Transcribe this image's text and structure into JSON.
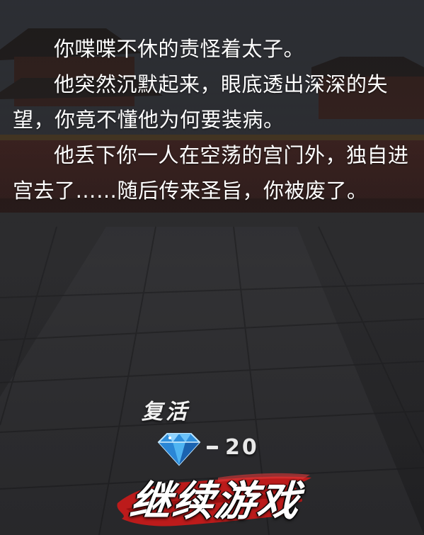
{
  "story": {
    "paragraphs": [
      "你喋喋不休的责怪着太子。",
      "他突然沉默起来，眼底透出深深的失望，你竟不懂他为何要装病。",
      "他丢下你一人在空荡的宫门外，独自进宫去了……随后传来圣旨，你被废了。"
    ]
  },
  "revive": {
    "label": "复活",
    "cost": "20",
    "currency_icon": "diamond-icon"
  },
  "continue_button": {
    "label": "继续游戏"
  },
  "colors": {
    "text": "#ffffff",
    "brush_red": "#c41a1a",
    "diamond_blue": "#3aa8ea"
  }
}
